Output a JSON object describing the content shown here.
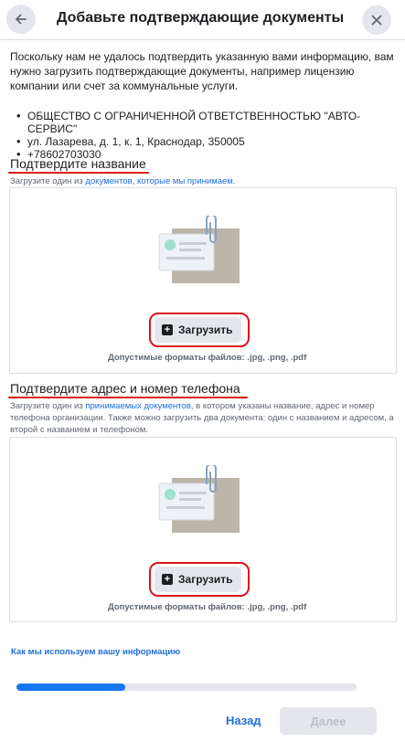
{
  "header": {
    "title": "Добавьте подтверждающие документы"
  },
  "intro": "Поскольку нам не удалось подтвердить указанную вами информацию, вам нужно загрузить подтверждающие документы, например лицензию компании или счет за коммунальные услуги.",
  "business": [
    "ОБЩЕСТВО С ОГРАНИЧЕННОЙ ОТВЕТСТВЕННОСТЬЮ \"АВТО-СЕРВИС\"",
    "ул. Лазарева, д. 1, к. 1, Краснодар, 350005",
    "+78602703030"
  ],
  "section_name": {
    "title": "Подтвердите название",
    "hint_prefix": "Загрузите один из ",
    "hint_link": "документов, которые мы принимаем",
    "hint_suffix": ".",
    "upload_label": "Загрузить",
    "formats": "Допустимые форматы файлов: .jpg, .png, .pdf"
  },
  "section_address": {
    "title": "Подтвердите адрес и номер телефона",
    "hint_prefix": "Загрузите один из ",
    "hint_link": "принимаемых документов",
    "hint_suffix": ", в котором указаны название, адрес и номер телефона организации. Также можно загрузить два документа: один с названием и адресом, а второй с названием и телефоном.",
    "upload_label": "Загрузить",
    "formats": "Допустимые форматы файлов: .jpg, .png, .pdf"
  },
  "info_link": "Как мы используем вашу информацию",
  "progress": 0.32,
  "footer": {
    "back_label": "Назад",
    "next_label": "Далее"
  },
  "colors": {
    "accent": "#1877f2",
    "link": "#216fdb",
    "annotation": "#d8161b"
  },
  "icons": {
    "back": "arrow-left-icon",
    "close": "close-icon",
    "upload": "plus-square-icon",
    "illustration": "document-clip-illustration"
  }
}
